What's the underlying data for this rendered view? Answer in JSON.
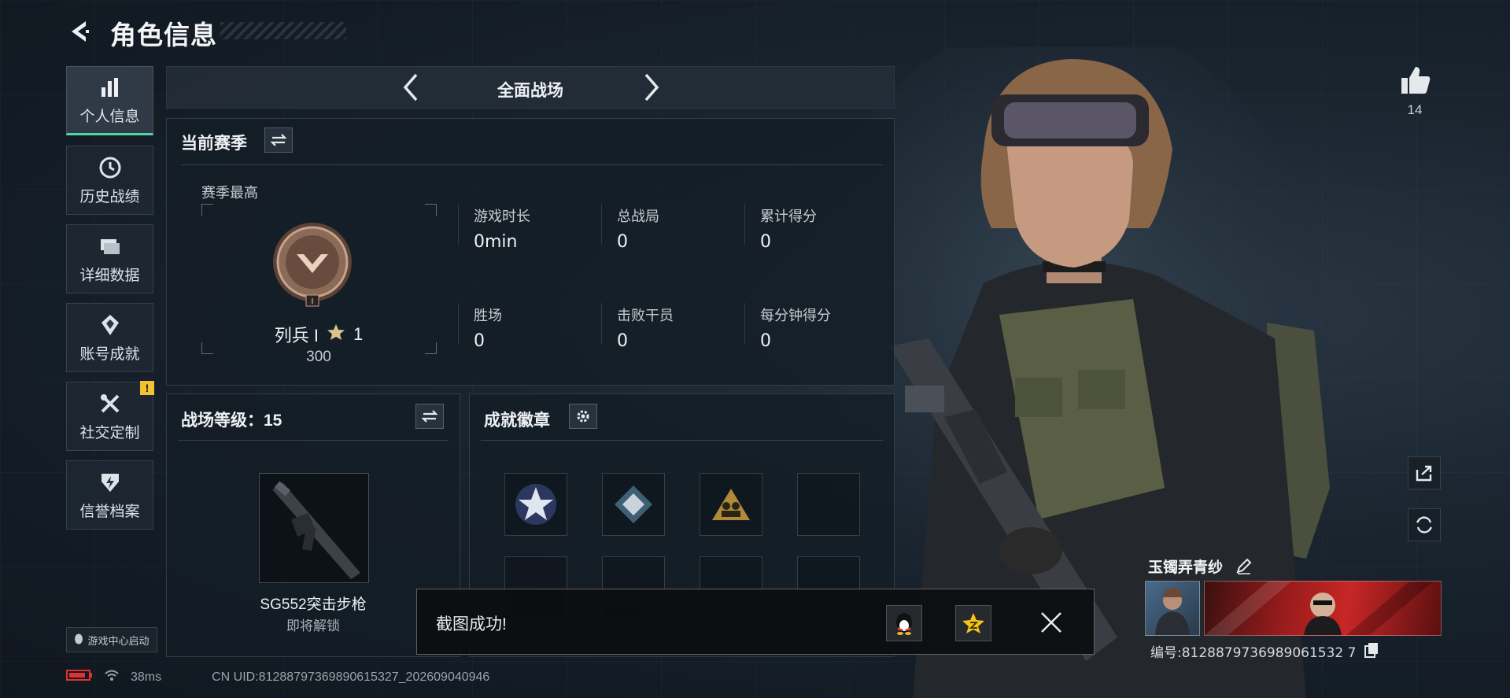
{
  "header": {
    "title": "角色信息"
  },
  "sidebar": {
    "items": [
      {
        "label": "个人信息",
        "icon": "bar-chart-icon",
        "active": true
      },
      {
        "label": "历史战绩",
        "icon": "history-clock-icon"
      },
      {
        "label": "详细数据",
        "icon": "folder-data-icon"
      },
      {
        "label": "账号成就",
        "icon": "achievement-icon"
      },
      {
        "label": "社交定制",
        "icon": "tools-icon",
        "badge": "!"
      },
      {
        "label": "信誉档案",
        "icon": "credit-shield-icon"
      }
    ],
    "game_center_label": "游戏中心启动"
  },
  "mode": {
    "name": "全面战场"
  },
  "season": {
    "title": "当前赛季",
    "best_label": "赛季最高",
    "rank_name": "列兵 I",
    "stars": "1",
    "rank_points": "300",
    "rank_numeral": "I",
    "stats": [
      {
        "label": "游戏时长",
        "value": "0min"
      },
      {
        "label": "总战局",
        "value": "0"
      },
      {
        "label": "累计得分",
        "value": "0"
      },
      {
        "label": "胜场",
        "value": "0"
      },
      {
        "label": "击败干员",
        "value": "0"
      },
      {
        "label": "每分钟得分",
        "value": "0"
      }
    ]
  },
  "level": {
    "title": "战场等级：15",
    "weapon_name": "SG552突击步枪",
    "weapon_status": "即将解锁"
  },
  "badges": {
    "title": "成就徽章"
  },
  "profile": {
    "likes": "14",
    "player_name": "玉镯弄青纱",
    "player_id": "编号:8128879736989061532 7"
  },
  "toast": {
    "message": "截图成功!"
  },
  "status_bar": {
    "ping": "38ms",
    "uid": "CN UID:81288797369890615327_202609040946"
  },
  "colors": {
    "accent": "#4fd6a3",
    "warning": "#f2c230",
    "panel": "#141d26"
  }
}
